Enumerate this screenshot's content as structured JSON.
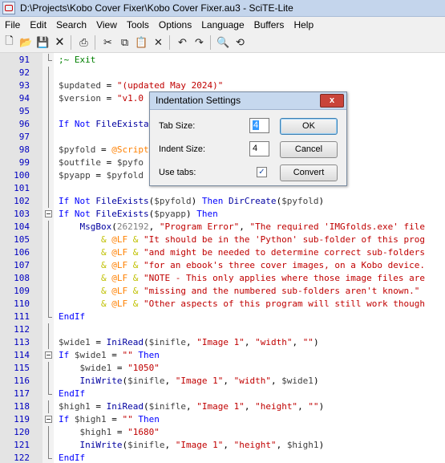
{
  "window": {
    "title": "D:\\Projects\\Kobo Cover Fixer\\Kobo Cover Fixer.au3 - SciTE-Lite"
  },
  "menu": [
    "File",
    "Edit",
    "Search",
    "View",
    "Tools",
    "Options",
    "Language",
    "Buffers",
    "Help"
  ],
  "toolbar": {
    "buttons": [
      {
        "name": "new-file-icon",
        "glyph": "🗋"
      },
      {
        "name": "open-folder-icon",
        "glyph": "📂"
      },
      {
        "name": "save-icon",
        "glyph": "💾"
      },
      {
        "name": "close-file-icon",
        "glyph": "🗙"
      },
      {
        "name": "sep"
      },
      {
        "name": "print-icon",
        "glyph": "⎙"
      },
      {
        "name": "sep"
      },
      {
        "name": "cut-icon",
        "glyph": "✂"
      },
      {
        "name": "copy-icon",
        "glyph": "⧉"
      },
      {
        "name": "paste-icon",
        "glyph": "📋"
      },
      {
        "name": "delete-icon",
        "glyph": "✕"
      },
      {
        "name": "sep"
      },
      {
        "name": "undo-icon",
        "glyph": "↶"
      },
      {
        "name": "redo-icon",
        "glyph": "↷"
      },
      {
        "name": "sep"
      },
      {
        "name": "find-icon",
        "glyph": "🔍"
      },
      {
        "name": "replace-icon",
        "glyph": "⟲"
      }
    ]
  },
  "editor": {
    "lines": [
      {
        "num": "91",
        "fold": "end",
        "segs": [
          [
            "cm",
            ";~ Exit"
          ]
        ]
      },
      {
        "num": "92",
        "fold": "vline",
        "segs": []
      },
      {
        "num": "93",
        "fold": "vline",
        "segs": [
          [
            "var",
            "$updated"
          ],
          [
            "plain",
            " = "
          ],
          [
            "str",
            "\"(updated May 2024)\""
          ]
        ]
      },
      {
        "num": "94",
        "fold": "vline",
        "segs": [
          [
            "var",
            "$version"
          ],
          [
            "plain",
            " = "
          ],
          [
            "str",
            "\"v1.0"
          ]
        ]
      },
      {
        "num": "95",
        "fold": "vline",
        "segs": []
      },
      {
        "num": "96",
        "fold": "vline",
        "segs": [
          [
            "kw",
            "If Not "
          ],
          [
            "fn",
            "FileExista"
          ]
        ]
      },
      {
        "num": "97",
        "fold": "vline",
        "segs": []
      },
      {
        "num": "98",
        "fold": "vline",
        "segs": [
          [
            "var",
            "$pyfold"
          ],
          [
            "plain",
            " = "
          ],
          [
            "mac",
            "@Script"
          ]
        ]
      },
      {
        "num": "99",
        "fold": "vline",
        "segs": [
          [
            "var",
            "$outfile"
          ],
          [
            "plain",
            " = "
          ],
          [
            "var",
            "$pyfo"
          ]
        ]
      },
      {
        "num": "100",
        "fold": "vline",
        "segs": [
          [
            "var",
            "$pyapp"
          ],
          [
            "plain",
            " = "
          ],
          [
            "var",
            "$pyfold"
          ]
        ]
      },
      {
        "num": "101",
        "fold": "vline",
        "segs": []
      },
      {
        "num": "102",
        "fold": "vline",
        "segs": [
          [
            "kw",
            "If Not "
          ],
          [
            "fn",
            "FileExists"
          ],
          [
            "plain",
            "("
          ],
          [
            "var",
            "$pyfold"
          ],
          [
            "plain",
            ") "
          ],
          [
            "kw",
            "Then "
          ],
          [
            "fn",
            "DirCreate"
          ],
          [
            "plain",
            "("
          ],
          [
            "var",
            "$pyfold"
          ],
          [
            "plain",
            ")"
          ]
        ]
      },
      {
        "num": "103",
        "fold": "box",
        "segs": [
          [
            "kw",
            "If Not "
          ],
          [
            "fn",
            "FileExists"
          ],
          [
            "plain",
            "("
          ],
          [
            "var",
            "$pyapp"
          ],
          [
            "plain",
            ") "
          ],
          [
            "kw",
            "Then"
          ]
        ]
      },
      {
        "num": "104",
        "fold": "vline",
        "segs": [
          [
            "plain",
            "    "
          ],
          [
            "fn",
            "MsgBox"
          ],
          [
            "plain",
            "("
          ],
          [
            "num",
            "262192"
          ],
          [
            "plain",
            ", "
          ],
          [
            "str",
            "\"Program Error\""
          ],
          [
            "plain",
            ", "
          ],
          [
            "str",
            "\"The required 'IMGfolds.exe' file"
          ]
        ]
      },
      {
        "num": "105",
        "fold": "vline",
        "segs": [
          [
            "plain",
            "        "
          ],
          [
            "op",
            "& "
          ],
          [
            "mac",
            "@LF"
          ],
          [
            "op",
            " & "
          ],
          [
            "str",
            "\"It should be in the 'Python' sub-folder of this prog"
          ]
        ]
      },
      {
        "num": "106",
        "fold": "vline",
        "segs": [
          [
            "plain",
            "        "
          ],
          [
            "op",
            "& "
          ],
          [
            "mac",
            "@LF"
          ],
          [
            "op",
            " & "
          ],
          [
            "str",
            "\"and might be needed to determine correct sub-folders"
          ]
        ]
      },
      {
        "num": "107",
        "fold": "vline",
        "segs": [
          [
            "plain",
            "        "
          ],
          [
            "op",
            "& "
          ],
          [
            "mac",
            "@LF"
          ],
          [
            "op",
            " & "
          ],
          [
            "str",
            "\"for an ebook's three cover images, on a Kobo device."
          ]
        ]
      },
      {
        "num": "108",
        "fold": "vline",
        "segs": [
          [
            "plain",
            "        "
          ],
          [
            "op",
            "& "
          ],
          [
            "mac",
            "@LF"
          ],
          [
            "op",
            " & "
          ],
          [
            "str",
            "\"NOTE - This only applies where those image files are"
          ]
        ]
      },
      {
        "num": "109",
        "fold": "vline",
        "segs": [
          [
            "plain",
            "        "
          ],
          [
            "op",
            "& "
          ],
          [
            "mac",
            "@LF"
          ],
          [
            "op",
            " & "
          ],
          [
            "str",
            "\"missing and the numbered sub-folders aren't known.\""
          ]
        ]
      },
      {
        "num": "110",
        "fold": "vline",
        "segs": [
          [
            "plain",
            "        "
          ],
          [
            "op",
            "& "
          ],
          [
            "mac",
            "@LF"
          ],
          [
            "op",
            " & "
          ],
          [
            "str",
            "\"Other aspects of this program will still work though"
          ]
        ]
      },
      {
        "num": "111",
        "fold": "end",
        "segs": [
          [
            "kw",
            "EndIf"
          ]
        ]
      },
      {
        "num": "112",
        "fold": "vline",
        "segs": []
      },
      {
        "num": "113",
        "fold": "vline",
        "segs": [
          [
            "var",
            "$wide1"
          ],
          [
            "plain",
            " = "
          ],
          [
            "fn",
            "IniRead"
          ],
          [
            "plain",
            "("
          ],
          [
            "var",
            "$inifle"
          ],
          [
            "plain",
            ", "
          ],
          [
            "str",
            "\"Image 1\""
          ],
          [
            "plain",
            ", "
          ],
          [
            "str",
            "\"width\""
          ],
          [
            "plain",
            ", "
          ],
          [
            "str",
            "\"\""
          ],
          [
            "plain",
            ")"
          ]
        ]
      },
      {
        "num": "114",
        "fold": "box",
        "segs": [
          [
            "kw",
            "If "
          ],
          [
            "var",
            "$wide1"
          ],
          [
            "plain",
            " = "
          ],
          [
            "str",
            "\"\""
          ],
          [
            "kw",
            " Then"
          ]
        ]
      },
      {
        "num": "115",
        "fold": "vline",
        "segs": [
          [
            "plain",
            "    "
          ],
          [
            "var",
            "$wide1"
          ],
          [
            "plain",
            " = "
          ],
          [
            "str",
            "\"1050\""
          ]
        ]
      },
      {
        "num": "116",
        "fold": "vline",
        "segs": [
          [
            "plain",
            "    "
          ],
          [
            "fn",
            "IniWrite"
          ],
          [
            "plain",
            "("
          ],
          [
            "var",
            "$inifle"
          ],
          [
            "plain",
            ", "
          ],
          [
            "str",
            "\"Image 1\""
          ],
          [
            "plain",
            ", "
          ],
          [
            "str",
            "\"width\""
          ],
          [
            "plain",
            ", "
          ],
          [
            "var",
            "$wide1"
          ],
          [
            "plain",
            ")"
          ]
        ]
      },
      {
        "num": "117",
        "fold": "end",
        "segs": [
          [
            "kw",
            "EndIf"
          ]
        ]
      },
      {
        "num": "118",
        "fold": "vline",
        "segs": [
          [
            "var",
            "$high1"
          ],
          [
            "plain",
            " = "
          ],
          [
            "fn",
            "IniRead"
          ],
          [
            "plain",
            "("
          ],
          [
            "var",
            "$inifle"
          ],
          [
            "plain",
            ", "
          ],
          [
            "str",
            "\"Image 1\""
          ],
          [
            "plain",
            ", "
          ],
          [
            "str",
            "\"height\""
          ],
          [
            "plain",
            ", "
          ],
          [
            "str",
            "\"\""
          ],
          [
            "plain",
            ")"
          ]
        ]
      },
      {
        "num": "119",
        "fold": "box",
        "segs": [
          [
            "kw",
            "If "
          ],
          [
            "var",
            "$high1"
          ],
          [
            "plain",
            " = "
          ],
          [
            "str",
            "\"\""
          ],
          [
            "kw",
            " Then"
          ]
        ]
      },
      {
        "num": "120",
        "fold": "vline",
        "segs": [
          [
            "plain",
            "    "
          ],
          [
            "var",
            "$high1"
          ],
          [
            "plain",
            " = "
          ],
          [
            "str",
            "\"1680\""
          ]
        ]
      },
      {
        "num": "121",
        "fold": "vline",
        "segs": [
          [
            "plain",
            "    "
          ],
          [
            "fn",
            "IniWrite"
          ],
          [
            "plain",
            "("
          ],
          [
            "var",
            "$inifle"
          ],
          [
            "plain",
            ", "
          ],
          [
            "str",
            "\"Image 1\""
          ],
          [
            "plain",
            ", "
          ],
          [
            "str",
            "\"height\""
          ],
          [
            "plain",
            ", "
          ],
          [
            "var",
            "$high1"
          ],
          [
            "plain",
            ")"
          ]
        ]
      },
      {
        "num": "122",
        "fold": "end",
        "segs": [
          [
            "kw",
            "EndIf"
          ]
        ]
      }
    ]
  },
  "dialog": {
    "title": "Indentation Settings",
    "close_glyph": "x",
    "tab_size_label": "Tab Size:",
    "tab_size_value": "4",
    "indent_size_label": "Indent Size:",
    "indent_size_value": "4",
    "use_tabs_label": "Use tabs:",
    "use_tabs_checked": true,
    "check_glyph": "✓",
    "ok_label": "OK",
    "cancel_label": "Cancel",
    "convert_label": "Convert"
  }
}
